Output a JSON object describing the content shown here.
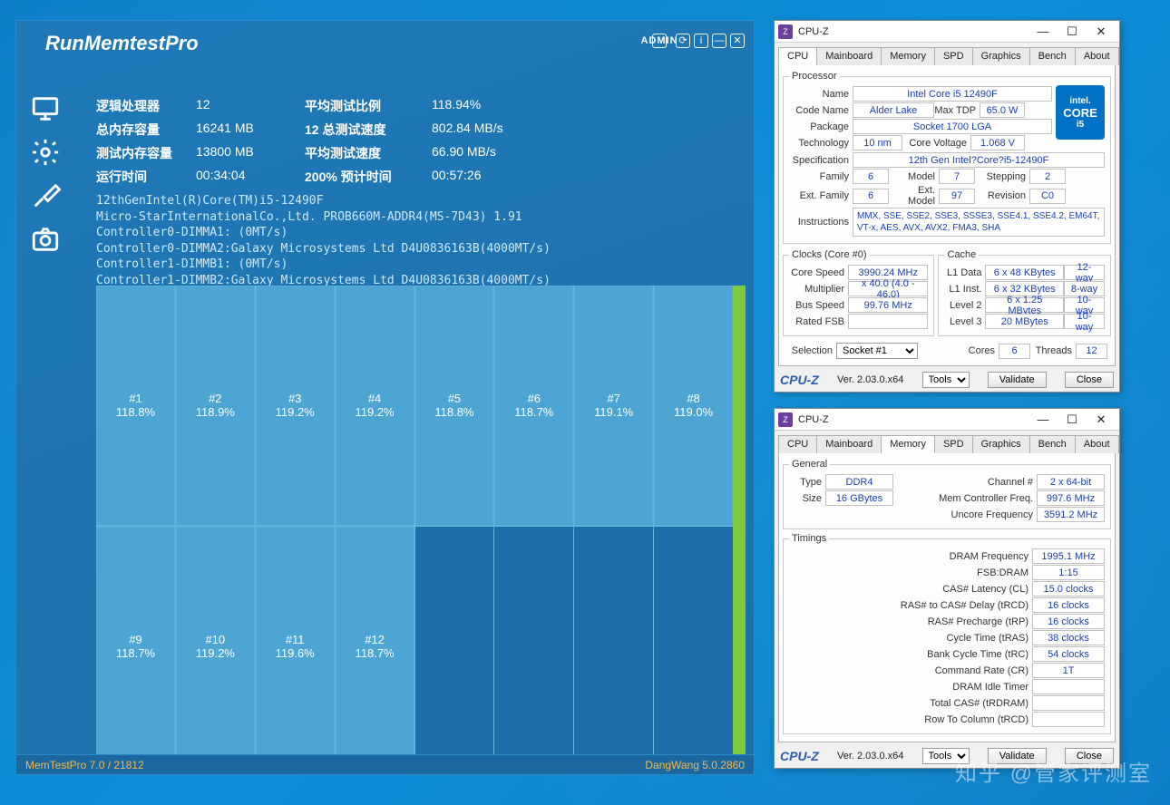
{
  "memtest": {
    "title": "RunMemtestPro",
    "admin": "ADMIN",
    "stats": {
      "logical_proc_label": "逻辑处理器",
      "logical_proc": "12",
      "avg_ratio_label": "平均测试比例",
      "avg_ratio": "118.94%",
      "total_mem_label": "总内存容量",
      "total_mem": "16241 MB",
      "test_speed_label": "12 总测试速度",
      "test_speed": "802.84 MB/s",
      "test_mem_label": "测试内存容量",
      "test_mem": "13800 MB",
      "avg_speed_label": "平均测试速度",
      "avg_speed": "66.90 MB/s",
      "runtime_label": "运行时间",
      "runtime": "00:34:04",
      "predict_label": "200% 预计时间",
      "predict": "00:57:26"
    },
    "log": "12thGenIntel(R)Core(TM)i5-12490F\nMicro-StarInternationalCo.,Ltd. PROB660M-ADDR4(MS-7D43) 1.91\nController0-DIMMA1: (0MT/s)\nController0-DIMMA2:Galaxy Microsystems Ltd D4U0836163B(4000MT/s)\nController1-DIMMB1: (0MT/s)\nController1-DIMMB2:Galaxy Microsystems Ltd D4U0836163B(4000MT/s)",
    "cells": [
      {
        "id": "#1",
        "pct": "118.8%"
      },
      {
        "id": "#2",
        "pct": "118.9%"
      },
      {
        "id": "#3",
        "pct": "119.2%"
      },
      {
        "id": "#4",
        "pct": "119.2%"
      },
      {
        "id": "#5",
        "pct": "118.8%"
      },
      {
        "id": "#6",
        "pct": "118.7%"
      },
      {
        "id": "#7",
        "pct": "119.1%"
      },
      {
        "id": "#8",
        "pct": "119.0%"
      },
      {
        "id": "#9",
        "pct": "118.7%"
      },
      {
        "id": "#10",
        "pct": "119.2%"
      },
      {
        "id": "#11",
        "pct": "119.6%"
      },
      {
        "id": "#12",
        "pct": "118.7%"
      }
    ],
    "footer_left": "MemTestPro 7.0 / 21812",
    "footer_right": "DangWang 5.0.2860"
  },
  "cpuz_tabs": [
    "CPU",
    "Mainboard",
    "Memory",
    "SPD",
    "Graphics",
    "Bench",
    "About"
  ],
  "cpuz1": {
    "title": "CPU-Z",
    "active_tab": "CPU",
    "processor": {
      "legend": "Processor",
      "name_l": "Name",
      "name": "Intel Core i5 12490F",
      "code_l": "Code Name",
      "code": "Alder Lake",
      "tdp_l": "Max TDP",
      "tdp": "65.0 W",
      "pkg_l": "Package",
      "pkg": "Socket 1700 LGA",
      "tech_l": "Technology",
      "tech": "10 nm",
      "cv_l": "Core Voltage",
      "cv": "1.068 V",
      "spec_l": "Specification",
      "spec": "12th Gen Intel?Core?i5-12490F",
      "fam_l": "Family",
      "fam": "6",
      "model_l": "Model",
      "model": "7",
      "step_l": "Stepping",
      "step": "2",
      "efam_l": "Ext. Family",
      "efam": "6",
      "emodel_l": "Ext. Model",
      "emodel": "97",
      "rev_l": "Revision",
      "rev": "C0",
      "inst_l": "Instructions",
      "inst": "MMX, SSE, SSE2, SSE3, SSSE3, SSE4.1, SSE4.2, EM64T, VT-x, AES, AVX, AVX2, FMA3, SHA",
      "logo_top": "intel.",
      "logo_mid": "CORE",
      "logo_bot": "i5"
    },
    "clocks": {
      "legend": "Clocks (Core #0)",
      "cs_l": "Core Speed",
      "cs": "3990.24 MHz",
      "mul_l": "Multiplier",
      "mul": "x 40.0 (4.0 - 46.0)",
      "bus_l": "Bus Speed",
      "bus": "99.76 MHz",
      "fsb_l": "Rated FSB",
      "fsb": ""
    },
    "cache": {
      "legend": "Cache",
      "l1d_l": "L1 Data",
      "l1d": "6 x 48 KBytes",
      "l1d_w": "12-way",
      "l1i_l": "L1 Inst.",
      "l1i": "6 x 32 KBytes",
      "l1i_w": "8-way",
      "l2_l": "Level 2",
      "l2": "6 x 1.25 MBytes",
      "l2_w": "10-way",
      "l3_l": "Level 3",
      "l3": "20 MBytes",
      "l3_w": "10-way"
    },
    "sel_l": "Selection",
    "sel": "Socket #1",
    "cores_l": "Cores",
    "cores": "6",
    "threads_l": "Threads",
    "threads": "12",
    "ver": "Ver. 2.03.0.x64",
    "tools": "Tools",
    "validate": "Validate",
    "close": "Close"
  },
  "cpuz2": {
    "title": "CPU-Z",
    "active_tab": "Memory",
    "general": {
      "legend": "General",
      "type_l": "Type",
      "type": "DDR4",
      "chan_l": "Channel #",
      "chan": "2 x 64-bit",
      "size_l": "Size",
      "size": "16 GBytes",
      "mcf_l": "Mem Controller Freq.",
      "mcf": "997.6 MHz",
      "ucf_l": "Uncore Frequency",
      "ucf": "3591.2 MHz"
    },
    "timings": {
      "legend": "Timings",
      "dram_l": "DRAM Frequency",
      "dram": "1995.1 MHz",
      "fsb_l": "FSB:DRAM",
      "fsb": "1:15",
      "cl_l": "CAS# Latency (CL)",
      "cl": "15.0 clocks",
      "trcd_l": "RAS# to CAS# Delay (tRCD)",
      "trcd": "16 clocks",
      "trp_l": "RAS# Precharge (tRP)",
      "trp": "16 clocks",
      "tras_l": "Cycle Time (tRAS)",
      "tras": "38 clocks",
      "trc_l": "Bank Cycle Time (tRC)",
      "trc": "54 clocks",
      "cr_l": "Command Rate (CR)",
      "cr": "1T",
      "idle_l": "DRAM Idle Timer",
      "idle": "",
      "trd_l": "Total CAS# (tRDRAM)",
      "trd": "",
      "rtc_l": "Row To Column (tRCD)",
      "rtc": ""
    },
    "ver": "Ver. 2.03.0.x64",
    "tools": "Tools",
    "validate": "Validate",
    "close": "Close"
  },
  "watermark": "知乎 @管家评测室"
}
